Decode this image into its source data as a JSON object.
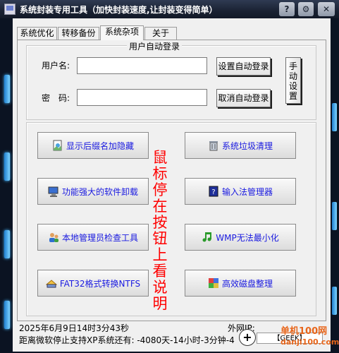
{
  "window": {
    "title": "系统封装专用工具（加快封装速度,让封装变得简单）",
    "controls": {
      "help": "?",
      "settings": "⚙",
      "close": "✕"
    }
  },
  "tabs": [
    "系统优化",
    "转移备份",
    "系统杂项",
    "关于"
  ],
  "active_tab": "系统杂项",
  "autologin": {
    "group_title": "用户自动登录",
    "username_label": "用户名:",
    "username_value": "",
    "password_label": "密　码:",
    "password_value": "",
    "set_button": "设置自动登录",
    "cancel_button": "取消自动登录",
    "manual_button": "手动设置"
  },
  "functions": {
    "left": [
      "显示后缀名加隐藏",
      "功能强大的软件卸载",
      "本地管理员检查工具",
      "FAT32格式转换NTFS"
    ],
    "right": [
      "系统垃圾清理",
      "输入法管理器",
      "WMP无法最小化",
      "高效磁盘整理"
    ],
    "hint": "鼠标停在按钮上看说明"
  },
  "status": {
    "datetime": "2025年6月9日14时3分43秒",
    "ip_label": "外网IP:",
    "xp_notice": "距离微软停止支持XP系统还有: -4080天-14小时-3分钟-4",
    "geek_label": "【GEEK】"
  },
  "watermark": {
    "text": "单机100网",
    "url": "danji100.com"
  },
  "colors": {
    "accent_blue": "#1a1ae0",
    "hint_red": "#ff0000",
    "watermark_orange": "#e8661b"
  }
}
